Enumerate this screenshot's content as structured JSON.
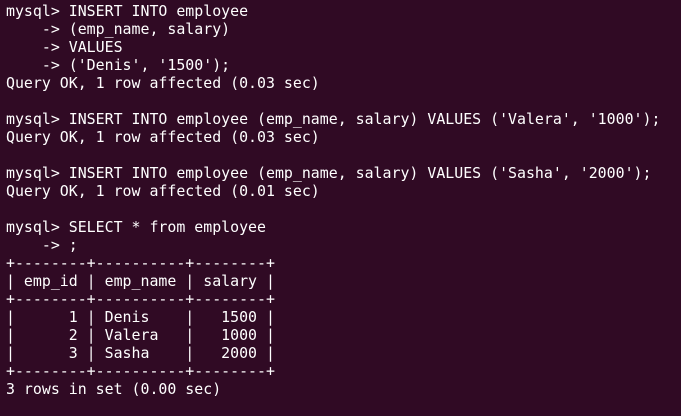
{
  "terminal": {
    "background": "#300a24",
    "foreground": "#ffffff",
    "lines": [
      "mysql> INSERT INTO employee",
      "    -> (emp_name, salary)",
      "    -> VALUES",
      "    -> ('Denis', '1500');",
      "Query OK, 1 row affected (0.03 sec)",
      "",
      "mysql> INSERT INTO employee (emp_name, salary) VALUES ('Valera', '1000');",
      "Query OK, 1 row affected (0.03 sec)",
      "",
      "mysql> INSERT INTO employee (emp_name, salary) VALUES ('Sasha', '2000');",
      "Query OK, 1 row affected (0.01 sec)",
      "",
      "mysql> SELECT * from employee",
      "    -> ;",
      "+--------+----------+--------+",
      "| emp_id | emp_name | salary |",
      "+--------+----------+--------+",
      "|      1 | Denis    |   1500 |",
      "|      2 | Valera   |   1000 |",
      "|      3 | Sasha    |   2000 |",
      "+--------+----------+--------+",
      "3 rows in set (0.00 sec)",
      ""
    ]
  }
}
